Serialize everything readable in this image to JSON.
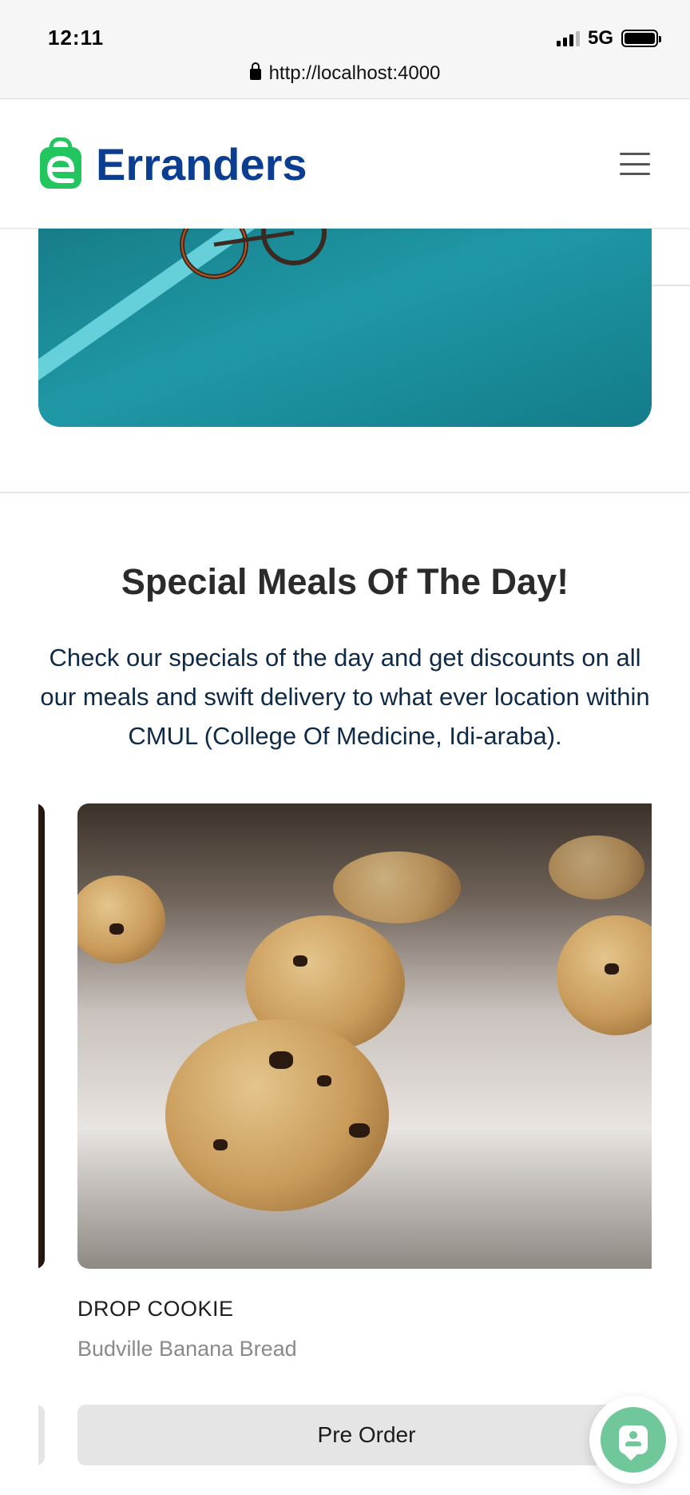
{
  "status_bar": {
    "time": "12:11",
    "network": "5G",
    "url": "http://localhost:4000"
  },
  "navbar": {
    "brand": "Erranders",
    "brand_color": "#0b3d91",
    "accent_color": "#22c55e"
  },
  "specials": {
    "title": "Special Meals Of The Day!",
    "description": "Check our specials of the day and get discounts on all our meals and swift delivery to what ever location within CMUL (College Of Medicine, Idi-araba)."
  },
  "meal_card": {
    "name": "DROP COOKIE",
    "vendor": "Budville Banana Bread",
    "button_label": "Pre Order"
  }
}
